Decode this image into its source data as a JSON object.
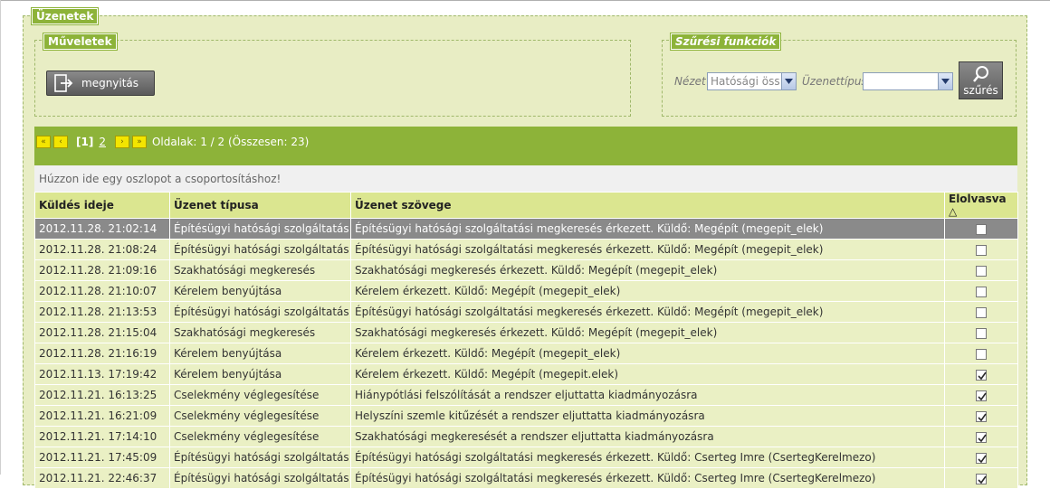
{
  "messages_panel": {
    "title": "Üzenetek"
  },
  "actions_panel": {
    "title": "Műveletek",
    "open_label": "megnyitás"
  },
  "filter_panel": {
    "title": "Szűrési funkciók",
    "view_label": "Nézet",
    "view_value": "Hatósági öss",
    "type_label": "Üzenettípus",
    "type_value": "",
    "filter_button": "szűrés"
  },
  "pager": {
    "first": "«",
    "prev": "‹",
    "current": "[1]",
    "page2": "2",
    "next": "›",
    "last": "»",
    "info": "Oldalak: 1 / 2 (Összesen: 23)"
  },
  "group_hint": "Húzzon ide egy oszlopot a csoportosításhoz!",
  "columns": {
    "sent": "Küldés ideje",
    "type": "Üzenet típusa",
    "text": "Üzenet szövege",
    "read": "Elolvasva",
    "sort_indicator": "△"
  },
  "rows": [
    {
      "sent": "2012.11.28. 21:02:14",
      "type": "Építésügyi hatósági szolgáltatás",
      "text": "Építésügyi hatósági szolgáltatási megkeresés érkezett. Küldő: Megépít (megepit_elek)",
      "read": false
    },
    {
      "sent": "2012.11.28. 21:08:24",
      "type": "Építésügyi hatósági szolgáltatás",
      "text": "Építésügyi hatósági szolgáltatási megkeresés érkezett. Küldő: Megépít (megepit_elek)",
      "read": false
    },
    {
      "sent": "2012.11.28. 21:09:16",
      "type": "Szakhatósági megkeresés",
      "text": "Szakhatósági megkeresés érkezett. Küldő: Megépít (megepit_elek)",
      "read": false
    },
    {
      "sent": "2012.11.28. 21:10:07",
      "type": "Kérelem benyújtása",
      "text": "Kérelem érkezett. Küldő: Megépít (megepit_elek)",
      "read": false
    },
    {
      "sent": "2012.11.28. 21:13:53",
      "type": "Építésügyi hatósági szolgáltatás",
      "text": "Építésügyi hatósági szolgáltatási megkeresés érkezett. Küldő: Megépít (megepit_elek)",
      "read": false
    },
    {
      "sent": "2012.11.28. 21:15:04",
      "type": "Szakhatósági megkeresés",
      "text": "Szakhatósági megkeresés érkezett. Küldő: Megépít (megepit_elek)",
      "read": false
    },
    {
      "sent": "2012.11.28. 21:16:19",
      "type": "Kérelem benyújtása",
      "text": "Kérelem érkezett. Küldő: Megépít (megepit_elek)",
      "read": false
    },
    {
      "sent": "2012.11.13. 17:19:42",
      "type": "Kérelem benyújtása",
      "text": "Kérelem érkezett. Küldő: Megépít (megepit.elek)",
      "read": true
    },
    {
      "sent": "2012.11.21. 16:13:25",
      "type": "Cselekmény véglegesítése",
      "text": "Hiánypótlási felszólítását a rendszer eljuttatta kiadmányozásra",
      "read": true
    },
    {
      "sent": "2012.11.21. 16:21:09",
      "type": "Cselekmény véglegesítése",
      "text": "Helyszíni szemle kitűzését a rendszer eljuttatta kiadmányozásra",
      "read": true
    },
    {
      "sent": "2012.11.21. 17:14:10",
      "type": "Cselekmény véglegesítése",
      "text": "Szakhatósági megkeresését a rendszer eljuttatta kiadmányozásra",
      "read": true
    },
    {
      "sent": "2012.11.21. 17:45:09",
      "type": "Építésügyi hatósági szolgáltatás",
      "text": "Építésügyi hatósági szolgáltatási megkeresés érkezett. Küldő: Cserteg Imre (CsertegKerelmezo)",
      "read": true
    },
    {
      "sent": "2012.11.21. 22:46:37",
      "type": "Építésügyi hatósági szolgáltatás",
      "text": "Építésügyi hatósági szolgáltatási megkeresés érkezett. Küldő: Cserteg Imre (CsertegKerelmezo)",
      "read": true
    }
  ],
  "colors": {
    "accent": "#8db339",
    "panel": "#e8edc4",
    "header": "#dbe690",
    "selected_row": "#8a8a8a",
    "pager_button": "#f3e500"
  },
  "icons": {
    "open": "open-document-icon",
    "search": "magnifier-icon",
    "dropdown": "chevron-down-icon",
    "checkbox_checked": "check-icon"
  }
}
